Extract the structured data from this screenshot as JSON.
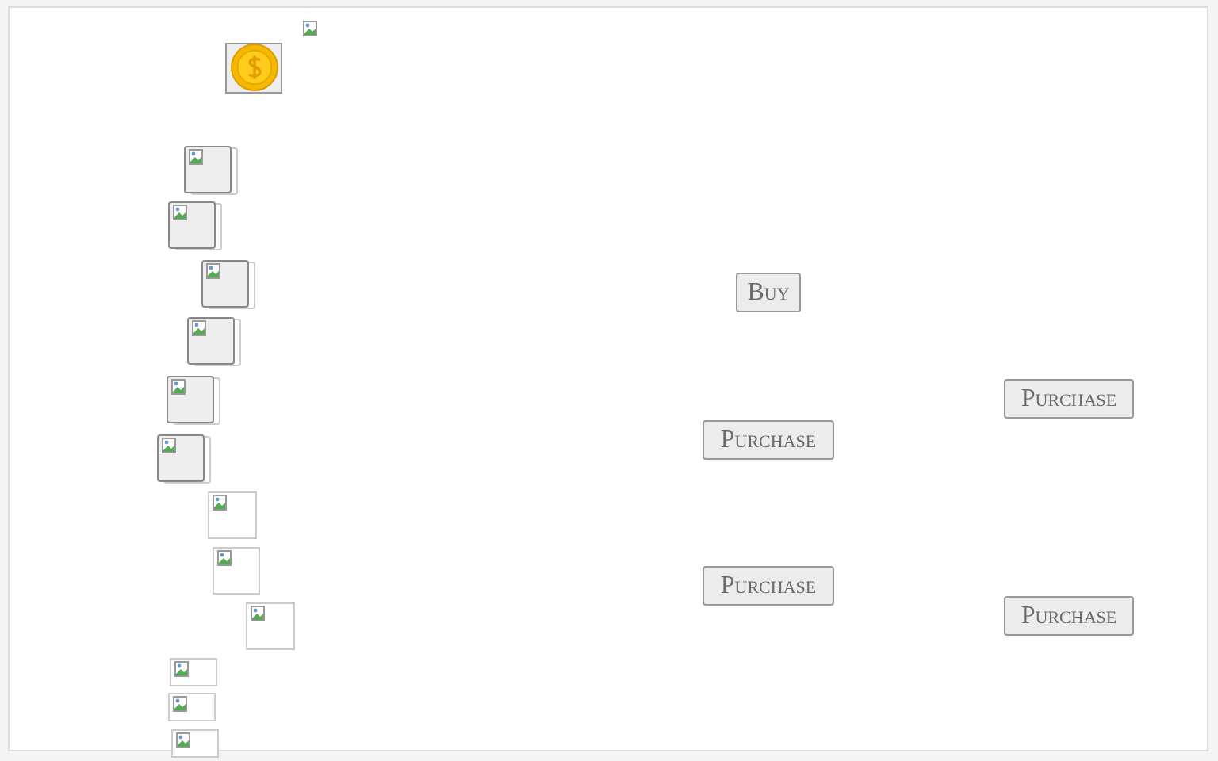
{
  "slots": [
    {
      "kind": "framed"
    },
    {
      "kind": "framed"
    },
    {
      "kind": "framed"
    },
    {
      "kind": "framed"
    },
    {
      "kind": "framed"
    },
    {
      "kind": "framed"
    },
    {
      "kind": "plain"
    },
    {
      "kind": "plain"
    },
    {
      "kind": "plain"
    },
    {
      "kind": "plain"
    },
    {
      "kind": "plain"
    },
    {
      "kind": "plain"
    }
  ],
  "buttons": [
    {
      "label": "Buy"
    },
    {
      "label": "Purchase"
    },
    {
      "label": "Purchase"
    },
    {
      "label": "Purchase"
    },
    {
      "label": "Purchase"
    }
  ]
}
